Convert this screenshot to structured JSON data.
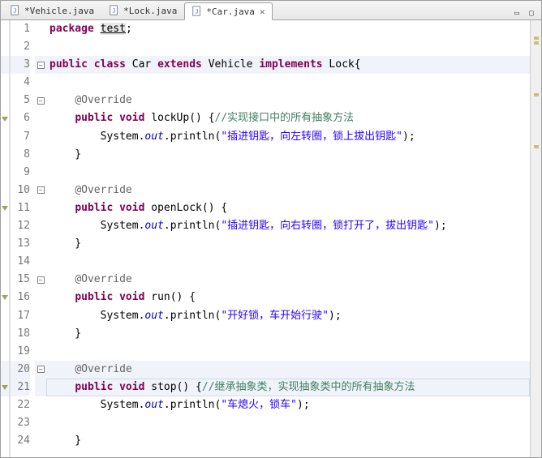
{
  "tabs": [
    {
      "label": "*Vehicle.java",
      "active": false
    },
    {
      "label": "*Lock.java",
      "active": false
    },
    {
      "label": "*Car.java",
      "active": true
    }
  ],
  "code": {
    "lines": [
      {
        "n": 1,
        "fold": "",
        "marker": "",
        "seg": [
          [
            "kw",
            "package"
          ],
          [
            "plain",
            " "
          ],
          [
            "hl-pkg",
            "test"
          ],
          [
            "plain",
            ";"
          ]
        ]
      },
      {
        "n": 2,
        "fold": "",
        "marker": "",
        "seg": []
      },
      {
        "n": 3,
        "fold": "minus",
        "marker": "",
        "hl": true,
        "seg": [
          [
            "kw",
            "public"
          ],
          [
            "plain",
            " "
          ],
          [
            "kw",
            "class"
          ],
          [
            "plain",
            " Car "
          ],
          [
            "kw",
            "extends"
          ],
          [
            "plain",
            " Vehicle "
          ],
          [
            "kw",
            "implements"
          ],
          [
            "plain",
            " Lock{"
          ]
        ]
      },
      {
        "n": 4,
        "fold": "",
        "marker": "",
        "seg": []
      },
      {
        "n": 5,
        "fold": "minus",
        "marker": "",
        "seg": [
          [
            "plain",
            "    "
          ],
          [
            "ann",
            "@Override"
          ]
        ]
      },
      {
        "n": 6,
        "fold": "",
        "marker": "ov",
        "seg": [
          [
            "plain",
            "    "
          ],
          [
            "kw",
            "public"
          ],
          [
            "plain",
            " "
          ],
          [
            "kw",
            "void"
          ],
          [
            "plain",
            " lockUp() {"
          ],
          [
            "cmt",
            "//实现接口中的所有抽象方法"
          ]
        ]
      },
      {
        "n": 7,
        "fold": "",
        "marker": "",
        "seg": [
          [
            "plain",
            "        System."
          ],
          [
            "sfield",
            "out"
          ],
          [
            "plain",
            ".println("
          ],
          [
            "str",
            "\"插进钥匙，向左转圈，锁上拔出钥匙\""
          ],
          [
            "plain",
            ");"
          ]
        ]
      },
      {
        "n": 8,
        "fold": "",
        "marker": "",
        "seg": [
          [
            "plain",
            "    }"
          ]
        ]
      },
      {
        "n": 9,
        "fold": "",
        "marker": "",
        "seg": []
      },
      {
        "n": 10,
        "fold": "minus",
        "marker": "",
        "seg": [
          [
            "plain",
            "    "
          ],
          [
            "ann",
            "@Override"
          ]
        ]
      },
      {
        "n": 11,
        "fold": "",
        "marker": "ov",
        "seg": [
          [
            "plain",
            "    "
          ],
          [
            "kw",
            "public"
          ],
          [
            "plain",
            " "
          ],
          [
            "kw",
            "void"
          ],
          [
            "plain",
            " openLock() {"
          ]
        ]
      },
      {
        "n": 12,
        "fold": "",
        "marker": "",
        "seg": [
          [
            "plain",
            "        System."
          ],
          [
            "sfield",
            "out"
          ],
          [
            "plain",
            ".println("
          ],
          [
            "str",
            "\"插进钥匙，向右转圈，锁打开了，拔出钥匙\""
          ],
          [
            "plain",
            ");"
          ]
        ]
      },
      {
        "n": 13,
        "fold": "",
        "marker": "",
        "seg": [
          [
            "plain",
            "    }"
          ]
        ]
      },
      {
        "n": 14,
        "fold": "",
        "marker": "",
        "seg": []
      },
      {
        "n": 15,
        "fold": "minus",
        "marker": "",
        "seg": [
          [
            "plain",
            "    "
          ],
          [
            "ann",
            "@Override"
          ]
        ]
      },
      {
        "n": 16,
        "fold": "",
        "marker": "ov",
        "seg": [
          [
            "plain",
            "    "
          ],
          [
            "kw",
            "public"
          ],
          [
            "plain",
            " "
          ],
          [
            "kw",
            "void"
          ],
          [
            "plain",
            " run() {"
          ]
        ]
      },
      {
        "n": 17,
        "fold": "",
        "marker": "",
        "seg": [
          [
            "plain",
            "        System."
          ],
          [
            "sfield",
            "out"
          ],
          [
            "plain",
            ".println("
          ],
          [
            "str",
            "\"开好锁，车开始行驶\""
          ],
          [
            "plain",
            ");"
          ]
        ]
      },
      {
        "n": 18,
        "fold": "",
        "marker": "",
        "seg": [
          [
            "plain",
            "    }"
          ]
        ]
      },
      {
        "n": 19,
        "fold": "",
        "marker": "",
        "seg": []
      },
      {
        "n": 20,
        "fold": "minus",
        "marker": "",
        "hl": true,
        "seg": [
          [
            "plain",
            "    "
          ],
          [
            "ann",
            "@Override"
          ]
        ]
      },
      {
        "n": 21,
        "fold": "",
        "marker": "ov",
        "hl": true,
        "cur": true,
        "seg": [
          [
            "plain",
            "    "
          ],
          [
            "kw",
            "public"
          ],
          [
            "plain",
            " "
          ],
          [
            "kw",
            "void"
          ],
          [
            "plain",
            " stop() {"
          ],
          [
            "cmt",
            "//继承抽象类，实现抽象类中的所有抽象方法"
          ]
        ]
      },
      {
        "n": 22,
        "fold": "",
        "marker": "",
        "seg": [
          [
            "plain",
            "        System."
          ],
          [
            "sfield",
            "out"
          ],
          [
            "plain",
            ".println("
          ],
          [
            "str",
            "\"车熄火，锁车\""
          ],
          [
            "plain",
            ");"
          ]
        ]
      },
      {
        "n": 23,
        "fold": "",
        "marker": "",
        "seg": [
          [
            "plain",
            "    "
          ]
        ]
      },
      {
        "n": 24,
        "fold": "",
        "marker": "",
        "seg": [
          [
            "plain",
            "    }"
          ]
        ]
      }
    ]
  }
}
